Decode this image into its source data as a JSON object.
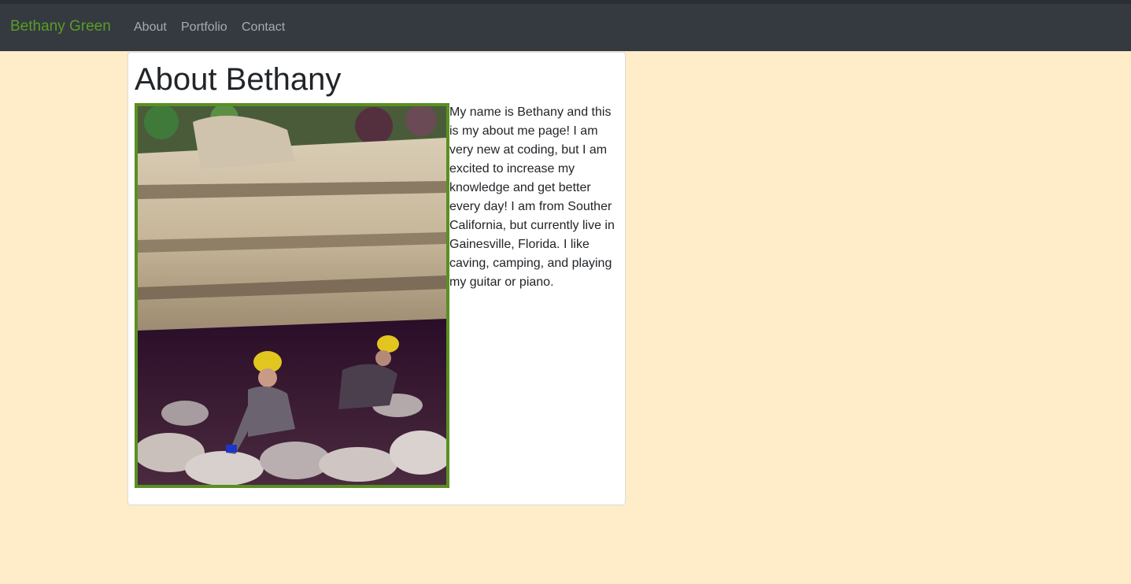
{
  "navbar": {
    "brand": "Bethany Green",
    "links": [
      "About",
      "Portfolio",
      "Contact"
    ]
  },
  "main": {
    "title": "About Bethany",
    "photo_alt": "Two cavers wearing helmets crawling out beneath a rock overhang",
    "bio": "My name is Bethany and this is my about me page! I am very new at coding, but I am excited to increase my knowledge and get better every day! I am from Souther California, but currently live in Gainesville, Florida. I like caving, camping, and playing my guitar or piano."
  },
  "colors": {
    "page_background": "#ffecc9",
    "navbar_background": "#343a40",
    "brand": "#5b9c25",
    "photo_border": "#5a8f22"
  }
}
